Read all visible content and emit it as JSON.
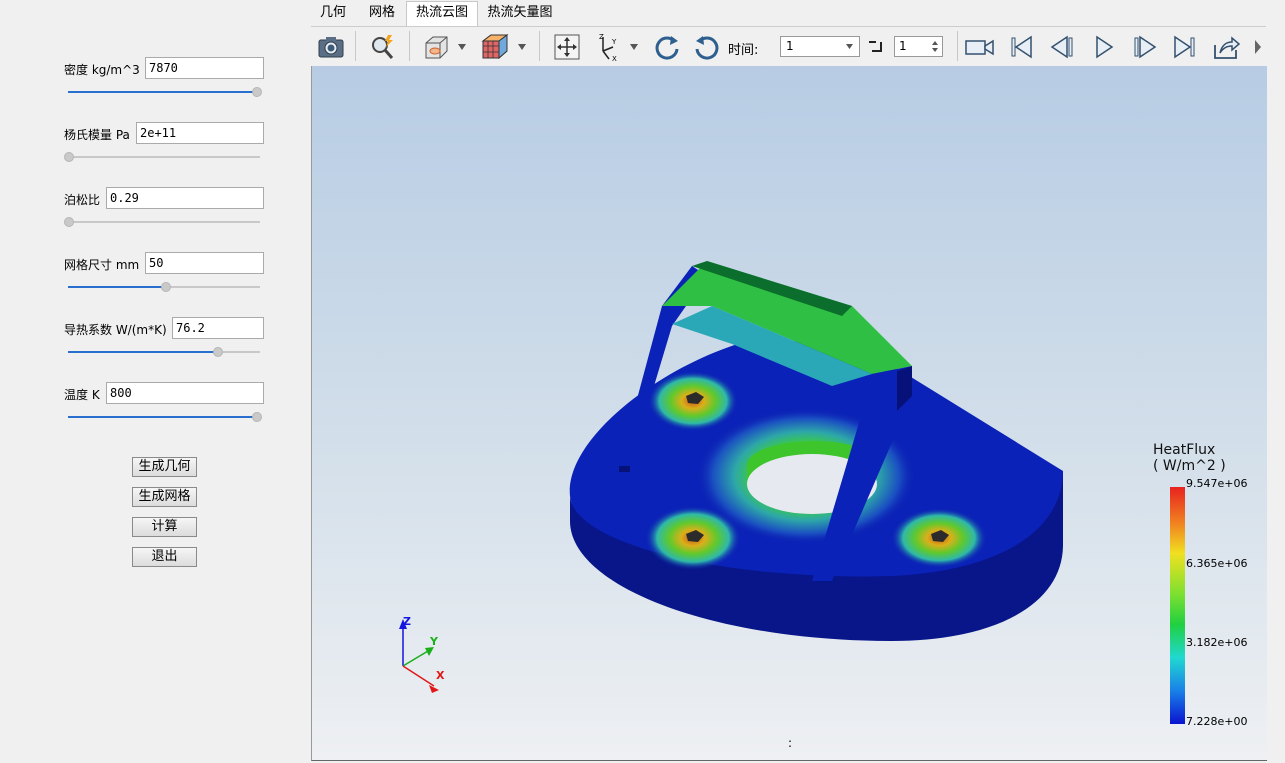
{
  "params": [
    {
      "label": "密度 kg/m^3",
      "value": "7870",
      "slider": 1.0
    },
    {
      "label": "杨氏模量 Pa",
      "value": "2e+11",
      "slider": 0.0
    },
    {
      "label": "泊松比",
      "value": "0.29",
      "slider": 0.0
    },
    {
      "label": "网格尺寸 mm",
      "value": "50",
      "slider": 0.5
    },
    {
      "label": "导热系数 W/(m*K)",
      "value": "76.2",
      "slider": 0.78
    },
    {
      "label": "温度 K",
      "value": "800",
      "slider": 1.0
    }
  ],
  "buttons": [
    "生成几何",
    "生成网格",
    "计算",
    "退出"
  ],
  "tabs": [
    "几何",
    "网格",
    "热流云图",
    "热流矢量图"
  ],
  "active_tab": "热流云图",
  "toolbar": {
    "time_label": "时间:",
    "time_value": "1",
    "step_value": "1",
    "icons": [
      "camera-icon",
      "zoom-icon",
      "view-box-icon",
      "color-cube-icon",
      "fit-icon",
      "axes-icon",
      "rotate-cw-icon",
      "rotate-ccw-icon",
      "record-icon",
      "first-frame-icon",
      "prev-frame-icon",
      "play-icon",
      "next-frame-icon",
      "last-frame-icon",
      "export-icon"
    ]
  },
  "legend": {
    "title": "HeatFlux",
    "unit": "( W/m^2 )",
    "ticks": [
      "9.547e+06",
      "6.365e+06",
      "3.182e+06",
      "7.228e+00"
    ]
  },
  "axes": {
    "x": "X",
    "y": "Y",
    "z": "Z"
  },
  "status_text": ":",
  "colors": {
    "accent": "#2a6fd0",
    "part_base": "#0a1fb0"
  }
}
